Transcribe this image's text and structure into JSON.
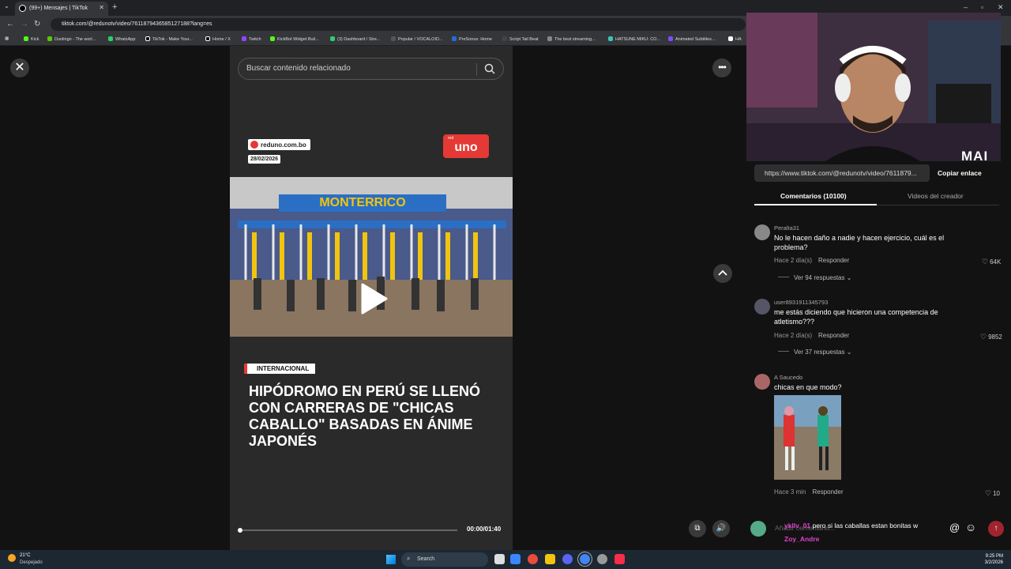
{
  "browser": {
    "tab_title": "(99+) Mensajes | TikTok",
    "url": "tiktok.com/@redunotv/video/7611879436585127188?lang=es",
    "bookmarks": [
      {
        "label": "Kick",
        "color": "#53fc18"
      },
      {
        "label": "Duolingo - The worl...",
        "color": "#58cc02"
      },
      {
        "label": "WhatsApp",
        "color": "#25d366"
      },
      {
        "label": "TikTok - Make Your...",
        "color": "#000000"
      },
      {
        "label": "Home / X",
        "color": "#000000"
      },
      {
        "label": "Twitch",
        "color": "#9146ff"
      },
      {
        "label": "KickBot Widget Buil...",
        "color": "#53fc18"
      },
      {
        "label": "(3) Dashboard / Stre...",
        "color": "#2ecc71"
      },
      {
        "label": "Popular / VOCALOID...",
        "color": "#333333"
      },
      {
        "label": "PreSonus: Home",
        "color": "#1e6fd9"
      },
      {
        "label": "Script Tail Beat",
        "color": "#444444"
      },
      {
        "label": "The best streaming...",
        "color": "#888888"
      },
      {
        "label": "HATSUNE MIKU: CO...",
        "color": "#39c5bb"
      },
      {
        "label": "Animated Subtitles...",
        "color": "#7c4dff"
      },
      {
        "label": "HA",
        "color": "#ffffff"
      }
    ]
  },
  "video": {
    "search_placeholder": "Buscar contenido relacionado",
    "source_site": "reduno.com.bo",
    "date": "28/02/2026",
    "logo_small": "red",
    "logo_big": "uno",
    "scene_sign": "MONTERRICO",
    "category_tag": "INTERNACIONAL",
    "headline": "HIPÓDROMO EN PERÚ SE LLENÓ CON CARRERAS DE \"CHICAS CABALLO\" BASADAS EN ÁNIME JAPONÉS",
    "timecode": "00:00/01:40",
    "progress": 0.0
  },
  "panel": {
    "streamer_tag": "MAI",
    "link": "https://www.tiktok.com/@redunotv/video/7611879...",
    "copy_label": "Copiar enlace",
    "tab_comments": "Comentarios (10100)",
    "tab_creator": "Videos del creador",
    "comments": [
      {
        "user": "Peralta31",
        "text": "No le hacen daño a nadie y hacen ejercicio, cuál es el problema?",
        "time": "Hace 2 día(s)",
        "reply": "Responder",
        "likes": "64K",
        "replies": "Ver 94 respuestas ⌄"
      },
      {
        "user": "user8931911345793",
        "text": "me estás diciendo que hicieron una competencia de atletismo???",
        "time": "Hace 2 día(s)",
        "reply": "Responder",
        "likes": "9852",
        "replies": "Ver 37 respuestas ⌄"
      },
      {
        "user": "A Saucedo",
        "text": "chicas en que modo?",
        "time": "Hace 3 min",
        "reply": "Responder",
        "likes": "10"
      }
    ],
    "composer_placeholder": "Añadir comentario...",
    "chat_user": "ykllv_01",
    "chat_text": "pero si las caballas estan bonitas w",
    "chat_user2": "Zoy_Andre"
  },
  "taskbar": {
    "temp": "21°C",
    "weather": "Despejado",
    "search": "Search",
    "time": "9:25 PM",
    "date": "3/2/2026"
  }
}
